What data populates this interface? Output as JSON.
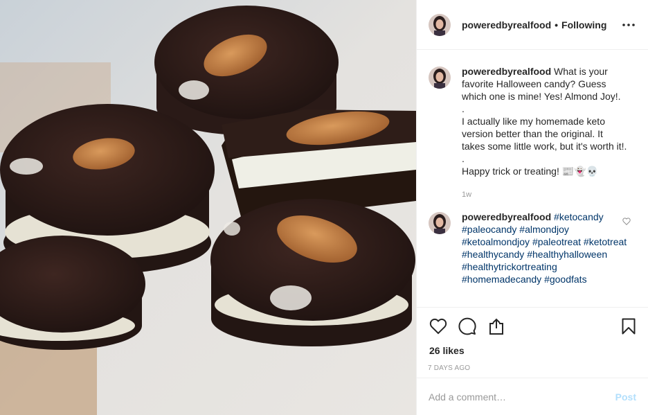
{
  "post": {
    "image_alt": "Homemade keto almond joy chocolate cups"
  },
  "header": {
    "username": "poweredbyrealfood",
    "separator": "•",
    "follow_status": "Following",
    "more_icon": "more-horizontal-icon"
  },
  "caption": {
    "username": "poweredbyrealfood",
    "text": "What is your favorite Halloween candy? Guess which one is mine! Yes! Almond Joy!.\n.\nI actually like my homemade keto version better than the original. It takes some little work, but it's worth it!.\n.\nHappy trick or treating! 📰👻💀",
    "time": "1w"
  },
  "comment": {
    "username": "poweredbyrealfood",
    "tags": [
      "#ketocandy",
      "#paleocandy",
      "#almondjoy",
      "#ketoalmondjoy",
      "#paleotreat",
      "#ketotreat",
      "#healthycandy",
      "#healthyhalloween",
      "#healthytrickortreating",
      "#homemadecandy",
      "#goodfats"
    ]
  },
  "actions": {
    "like_icon": "heart-icon",
    "comment_icon": "comment-icon",
    "share_icon": "share-icon",
    "save_icon": "bookmark-icon"
  },
  "likes": "26 likes",
  "timestamp": "7 DAYS AGO",
  "add_comment": {
    "placeholder": "Add a comment…",
    "post_label": "Post"
  },
  "colors": {
    "link": "#003569",
    "muted": "#999999",
    "post_disabled": "#b2dffc",
    "border": "#efefef"
  }
}
